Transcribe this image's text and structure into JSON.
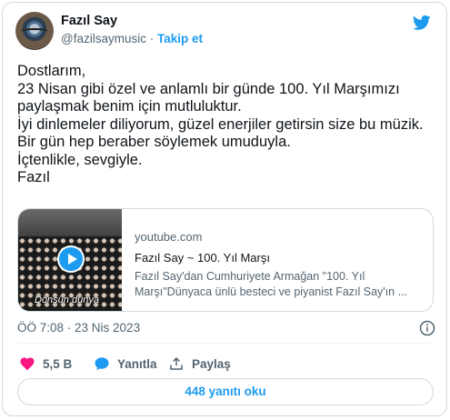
{
  "author": {
    "name": "Fazıl Say",
    "handle": "@fazilsaymusic",
    "separator": "·",
    "follow_label": "Takip et"
  },
  "tweet": {
    "text": "Dostlarım,\n23 Nisan gibi özel ve anlamlı bir günde 100. Yıl Marşımızı paylaşmak benim için mutluluktur.\nİyi dinlemeler diliyorum, güzel enerjiler getirsin size bu müzik. Bir gün hep beraber söylemek umuduyla.\nİçtenlikle, sevgiyle.\nFazıl"
  },
  "link_card": {
    "domain": "youtube.com",
    "title": "Fazıl Say ~ 100. Yıl Marşı",
    "description": "Fazıl Say'dan Cumhuriyete Armağan \"100. Yıl Marşı\"Dünyaca ünlü besteci ve piyanist Fazıl Say'ın ...",
    "thumbnail_caption": "Dönsün dünya"
  },
  "timestamp": "ÖÖ 7:08 · 23 Nis 2023",
  "actions": {
    "likes": "5,5 B",
    "reply_label": "Yanıtla",
    "share_label": "Paylaş"
  },
  "read_replies_label": "448 yanıtı oku",
  "colors": {
    "accent": "#1d9bf0",
    "like": "#f91880",
    "text": "#0f1419",
    "secondary": "#536471"
  },
  "icons": [
    "twitter-bird-icon",
    "play-icon",
    "info-icon",
    "heart-icon",
    "reply-bubble-icon",
    "share-icon"
  ]
}
